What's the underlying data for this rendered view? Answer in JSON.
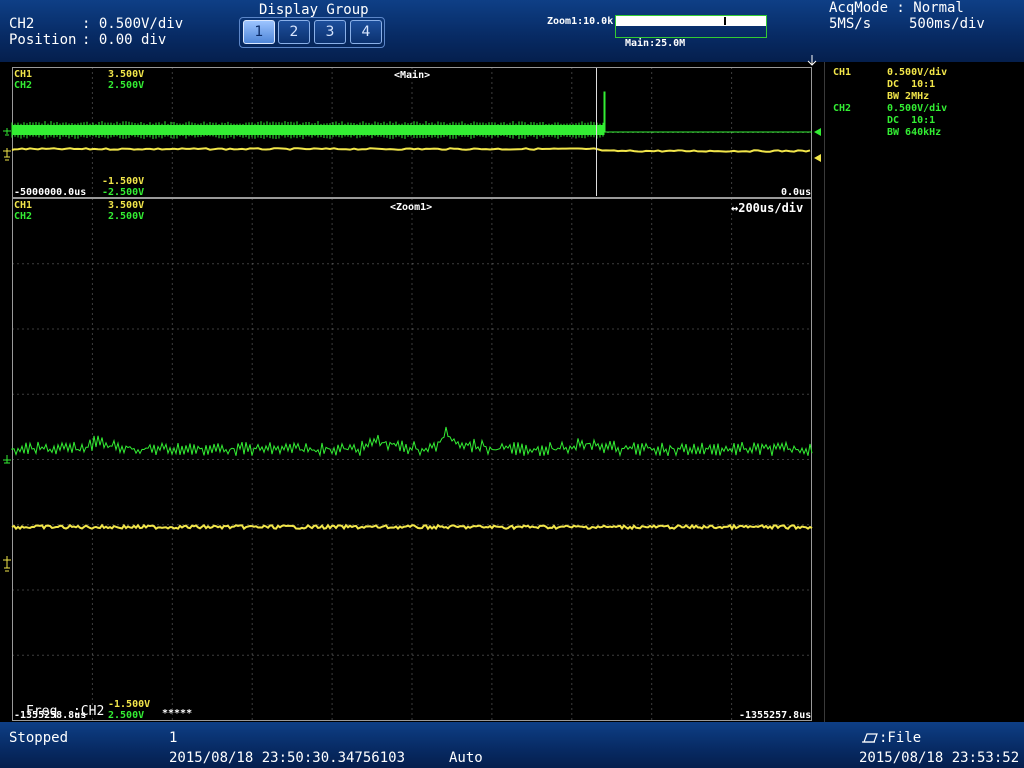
{
  "top": {
    "ch_label": "CH2",
    "ch_value": ": 0.500V/div",
    "position_label": "Position",
    "position_value": ": 0.00 div",
    "display_group_title": "Display Group",
    "display_group_buttons": [
      "1",
      "2",
      "3",
      "4"
    ],
    "zoom_label": "Zoom1:10.0k",
    "main_label": "Main:25.0M",
    "acqmode": "AcqMode : Normal",
    "sample_rate": "5MS/s",
    "timebase": "500ms/div"
  },
  "main": {
    "ch1_name": "CH1",
    "ch1_top": "3.500V",
    "ch2_name": "CH2",
    "ch2_top": "2.500V",
    "title": "<Main>",
    "ch1_bottom": "-1.500V",
    "ch2_bottom": "-2.500V",
    "left_time": "-5000000.0us",
    "right_time": "0.0us"
  },
  "zoom": {
    "ch1_name": "CH1",
    "ch1_top": "3.500V",
    "ch2_name": "CH2",
    "ch2_top": "2.500V",
    "title": "<Zoom1>",
    "timebase": "↔200us/div",
    "ch1_bottom": "-1.500V",
    "ch2_bottom": "2.500V",
    "left_time": "-1355258.8us",
    "right_time": "-1355257.8us",
    "freq_label": "Freq  :CH2",
    "freq_value": "*****"
  },
  "channels": {
    "ch1": {
      "name": "CH1",
      "vdiv": "0.500V/div",
      "coupling": "DC  10:1",
      "bw": "BW 2MHz"
    },
    "ch2": {
      "name": "CH2",
      "vdiv": "0.500V/div",
      "coupling": "DC  10:1",
      "bw": "BW 640kHz"
    }
  },
  "bottom": {
    "status": "Stopped",
    "acq_count": "1",
    "trigger_time": "2015/08/18 23:50:30.34756103",
    "trigger_mode": "Auto",
    "file_label": ":File",
    "clock": "2015/08/18 23:53:52"
  },
  "colors": {
    "ch1": "#f2e64a",
    "ch2": "#33ee33",
    "bar": "#0a3272",
    "grid": "#7a7a7a"
  }
}
